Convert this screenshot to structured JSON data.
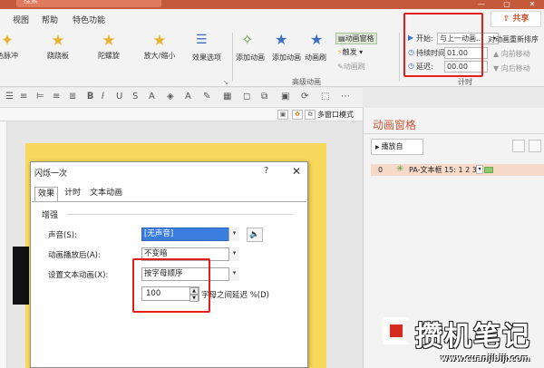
{
  "titlebar": {
    "search_placeholder": "搜索",
    "min": "—",
    "max": "▢",
    "close": "✕"
  },
  "menu": {
    "tabs": [
      "视图",
      "帮助",
      "特色功能"
    ],
    "share": "共享"
  },
  "ribbon": {
    "effects": [
      "色脉冲",
      "跷跷板",
      "陀螺旋",
      "放大/缩小"
    ],
    "effect_options": "效果选项",
    "add_animation": "添加动画",
    "animation_painter": "动画刷",
    "animation_pane": "动画窗格",
    "trigger": "触发",
    "animation_brush": "动画刷",
    "advanced_group": "高级动画",
    "start_label": "开始:",
    "start_value": "与上一动画...",
    "duration_label": "持续时间:",
    "duration_value": "01.00",
    "delay_label": "延迟:",
    "delay_value": "00.00",
    "timing_group": "计时",
    "reorder_label": "对动画重新排序",
    "move_earlier": "向前移动",
    "move_later": "向后移动",
    "star_colors": {
      "emphasis": "#e6b432",
      "add": "#5a9b3b",
      "brush": "#3b6fc2"
    }
  },
  "toolbar": {
    "multi_window": "多窗口模式"
  },
  "dialog": {
    "title": "闪烁一次",
    "help": "?",
    "close": "✕",
    "tabs": [
      "效果",
      "计时",
      "文本动画"
    ],
    "section": "增强",
    "rows": [
      {
        "label": "声音(S):",
        "value": "[无声音]"
      },
      {
        "label": "动画播放后(A):",
        "value": "不变暗"
      },
      {
        "label": "设置文本动画(X):",
        "value": "按字母顺序"
      }
    ],
    "spin_value": "100",
    "delay_text": "字母之间延迟 %(D)"
  },
  "pane": {
    "title": "动画窗格",
    "play": "播放自",
    "item_number": "0",
    "item_name": "PA-文本框 15: 1 2 3..."
  },
  "watermark": {
    "text": "攒机笔记",
    "url": "www.cuanjibiji.com"
  },
  "colors": {
    "accent": "#c55a3a",
    "highlight": "#e0201c",
    "slide": "#f8d85a"
  }
}
